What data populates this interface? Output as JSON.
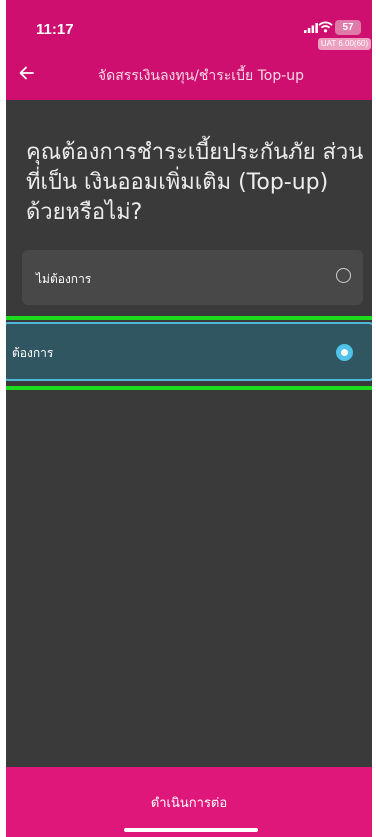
{
  "status_bar": {
    "time": "11:17",
    "battery": "57",
    "env_badge": "UAT 6.00(60)"
  },
  "header": {
    "title": "จัดสรรเงินลงทุน/ชำระเบี้ย Top-up",
    "back_icon": "arrow-left-icon"
  },
  "question": "คุณต้องการชำระเบี้ยประกันภัย ส่วนที่เป็น เงินออมเพิ่มเติม (Top-up) ด้วยหรือไม่?",
  "options": [
    {
      "label": "ไม่ต้องการ",
      "selected": false
    },
    {
      "label": "ต้องการ",
      "selected": true
    }
  ],
  "footer": {
    "continue_label": "ดำเนินการต่อ"
  },
  "colors": {
    "brand": "#cf0f6f",
    "footer": "#e0177a",
    "background": "#3a3a3a",
    "selected_option": "#2f5661",
    "selected_accent": "#4fc3ea",
    "highlight": "#1ddc1d"
  }
}
